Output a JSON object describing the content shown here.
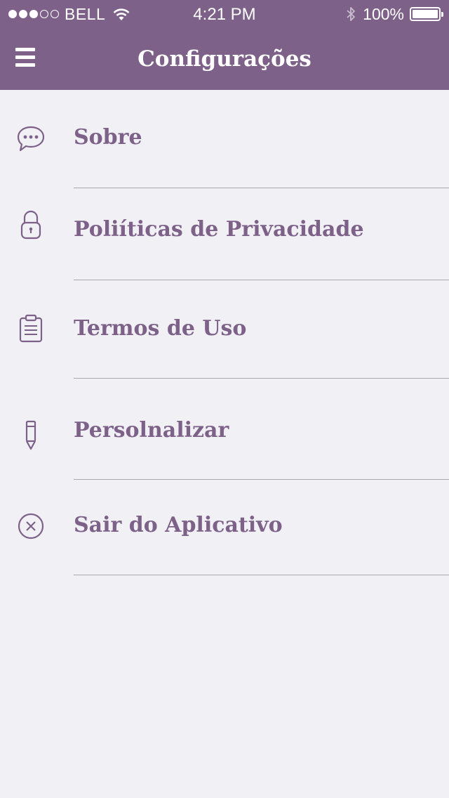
{
  "status_bar": {
    "carrier": "BELL",
    "time": "4:21 PM",
    "battery": "100%",
    "signal_bars": 3,
    "signal_total": 5
  },
  "header": {
    "title": "Configurações",
    "menu_icon": "hamburger-menu-icon"
  },
  "menu": {
    "items": [
      {
        "label": "Sobre",
        "icon": "chat-bubble-icon"
      },
      {
        "label": "Poliíticas de Privacidade",
        "icon": "lock-icon"
      },
      {
        "label": "Termos de Uso",
        "icon": "clipboard-icon"
      },
      {
        "label": "Persolnalizar",
        "icon": "pencil-icon"
      },
      {
        "label": "Sair do Aplicativo",
        "icon": "close-circle-icon"
      }
    ]
  },
  "colors": {
    "accent": "#7d6189",
    "background": "#f0f0f5",
    "divider": "#a9a9ad",
    "header_text": "#ffffff"
  }
}
